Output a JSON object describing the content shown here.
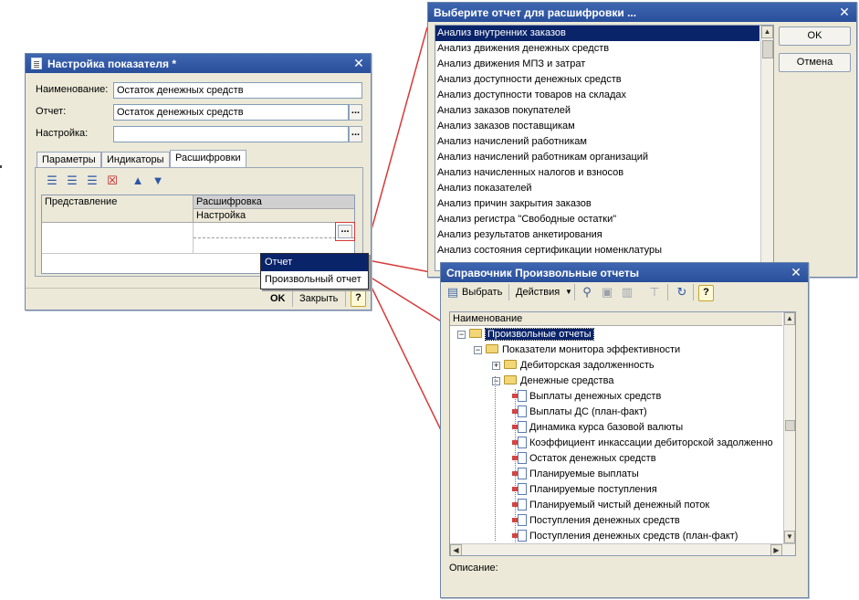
{
  "settings_window": {
    "title": "Настройка показателя *",
    "name_label": "Наименование:",
    "name_value": "Остаток денежных средств",
    "report_label": "Отчет:",
    "report_value": "Остаток денежных средств",
    "setting_label": "Настройка:",
    "setting_value": "",
    "dots": "...",
    "tabs": [
      "Параметры",
      "Индикаторы",
      "Расшифровки"
    ],
    "grid_headers": {
      "col1": "Представление",
      "col2a": "Расшифровка",
      "col2b": "Настройка"
    },
    "ok_label": "OK",
    "close_label": "Закрыть",
    "help": "?"
  },
  "popup_menu": {
    "items": [
      "Отчет",
      "Произвольный отчет"
    ]
  },
  "select_report_window": {
    "title": "Выберите отчет для расшифровки ...",
    "items": [
      "Анализ внутренних заказов",
      "Анализ движения денежных средств",
      "Анализ движения МПЗ и затрат",
      "Анализ доступности денежных средств",
      "Анализ доступности товаров на складах",
      "Анализ заказов покупателей",
      "Анализ заказов поставщикам",
      "Анализ начислений работникам",
      "Анализ начислений работникам организаций",
      "Анализ начисленных налогов и взносов",
      "Анализ показателей",
      "Анализ причин закрытия заказов",
      "Анализ регистра \"Свободные остатки\"",
      "Анализ результатов анкетирования",
      "Анализ состояния сертификации номенклатуры"
    ],
    "ok_label": "OK",
    "cancel_label": "Отмена"
  },
  "catalog_window": {
    "title": "Справочник Произвольные отчеты",
    "toolbar": {
      "select_label": "Выбрать",
      "actions_label": "Действия",
      "help": "?"
    },
    "column_header": "Наименование",
    "tree": [
      {
        "label": "Произвольные отчеты",
        "kind": "folder",
        "level": 0
      },
      {
        "label": "Показатели монитора эффективности",
        "kind": "folder",
        "level": 1
      },
      {
        "label": "Дебиторская задолженность",
        "kind": "folder",
        "level": 2
      },
      {
        "label": "Денежные средства",
        "kind": "folder",
        "level": 2
      },
      {
        "label": "Выплаты денежных средств",
        "kind": "report",
        "level": 3
      },
      {
        "label": "Выплаты ДС (план-факт)",
        "kind": "report",
        "level": 3
      },
      {
        "label": "Динамика курса базовой валюты",
        "kind": "report",
        "level": 3
      },
      {
        "label": "Коэффициент инкассации дебиторской задолженно",
        "kind": "report",
        "level": 3
      },
      {
        "label": "Остаток денежных средств",
        "kind": "report",
        "level": 3
      },
      {
        "label": "Планируемые выплаты",
        "kind": "report",
        "level": 3
      },
      {
        "label": "Планируемые поступления",
        "kind": "report",
        "level": 3
      },
      {
        "label": "Планируемый чистый денежный поток",
        "kind": "report",
        "level": 3
      },
      {
        "label": "Поступления денежных средств",
        "kind": "report",
        "level": 3
      },
      {
        "label": "Поступления денежных средств (план-факт)",
        "kind": "report",
        "level": 3
      }
    ],
    "description_label": "Описание:"
  }
}
